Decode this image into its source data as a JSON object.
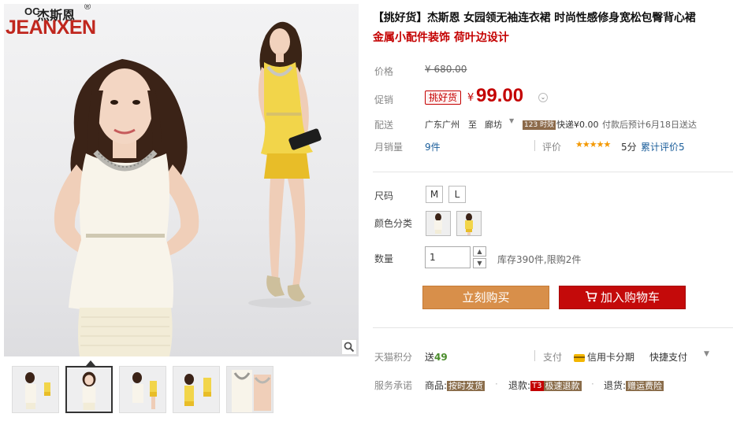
{
  "brand": {
    "logo_mark": "OC",
    "name_cn": "杰斯恩",
    "registered": "®",
    "name_en": "JEANXEN"
  },
  "gallery": {
    "zoom_icon": "magnifier-icon",
    "thumbnail_count": 5,
    "active_thumbnail_index": 1
  },
  "product": {
    "title": "【挑好货】杰斯恩 女园领无袖连衣裙 时尚性感修身宽松包臀背心裙",
    "subtitle": "金属小配件装饰 荷叶边设计"
  },
  "price": {
    "label": "价格",
    "original": "¥ 680.00",
    "promo_label": "促销",
    "promo_tag": "挑好货",
    "currency": "¥",
    "current": "99.00"
  },
  "shipping": {
    "label": "配送",
    "from": "广东广州",
    "to_word": "至",
    "destination": "廊坊",
    "badge": "123 时效",
    "express": "快递¥0.00",
    "eta": "付款后预计6月18日送达"
  },
  "sales": {
    "label": "月销量",
    "count": "9件",
    "review_label": "评价",
    "stars": "★★★★★",
    "score": "5分",
    "total_reviews_label": "累计评价",
    "total_reviews_count": "5"
  },
  "options": {
    "size_label": "尺码",
    "sizes": [
      "M",
      "L"
    ],
    "color_label": "颜色分类",
    "colors": [
      "white",
      "yellow"
    ]
  },
  "quantity": {
    "label": "数量",
    "value": "1",
    "up": "▲",
    "down": "▼",
    "stock": "库存390件,限购2件"
  },
  "actions": {
    "buy_now": "立刻购买",
    "add_to_cart": "加入购物车"
  },
  "extras": {
    "points_label": "天猫积分",
    "points_prefix": "送",
    "points_value": "49",
    "pay_label": "支付",
    "installment": "信用卡分期",
    "quick_pay": "快捷支付",
    "service_label": "服务承诺",
    "service_goods": "商品:",
    "service_goods_tag": "按时发货",
    "service_refund": "退款:",
    "service_refund_t3": "T3",
    "service_refund_tag": "极速退款",
    "service_return": "退货:",
    "service_return_tag": "赠运费险"
  }
}
